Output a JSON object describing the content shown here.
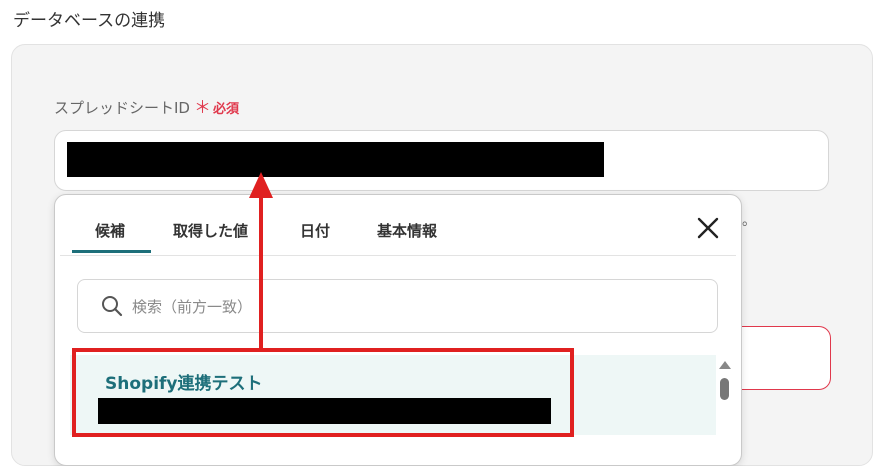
{
  "header": {
    "section_title": "データベースの連携"
  },
  "field": {
    "label": "スプレッドシートID",
    "required_star": "＊",
    "required_text": "必須"
  },
  "popup": {
    "tabs": [
      {
        "label": "候補"
      },
      {
        "label": "取得した値"
      },
      {
        "label": "日付"
      },
      {
        "label": "基本情報"
      }
    ],
    "active_tab": "候補",
    "search": {
      "placeholder": "検索（前方一致）"
    },
    "list": [
      {
        "title": "Shopify連携テスト"
      }
    ]
  },
  "stray_text": "。",
  "colors": {
    "accent": "#1d6f7a",
    "required": "#e0384c",
    "annotation_red": "#e02020",
    "list_item_bg": "#eef7f6"
  },
  "icons": {
    "close": "close-icon",
    "search": "search-icon"
  }
}
